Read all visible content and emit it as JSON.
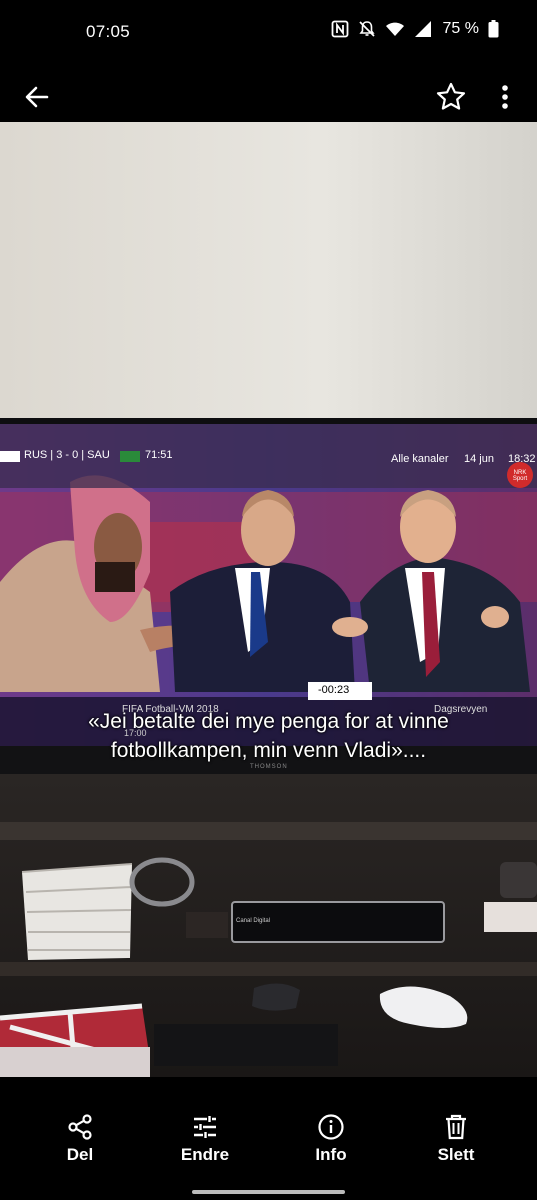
{
  "status": {
    "time": "07:05",
    "battery": "75 %",
    "icons": [
      "nfc-icon",
      "mute-icon",
      "wifi-icon",
      "signal-icon",
      "battery-icon"
    ]
  },
  "appbar": {
    "icons": [
      "back-arrow-icon",
      "star-icon",
      "more-vert-icon"
    ]
  },
  "photo": {
    "tv_overlay": {
      "score": "RUS | 3 - 0 | SAU",
      "match_time": "71:51",
      "channel_label": "Alle kanaler",
      "date": "14 jun",
      "clock": "18:32",
      "badge": "NRK Sport",
      "program": "FIFA Fotball-VM 2018",
      "program_time": "17:00",
      "next_program": "Dagsrevyen",
      "player_time": "-00:23",
      "brand": "THOMSON"
    },
    "caption_lines": [
      "«Jei betalte dei mye penga for at vinne",
      "fotbollkampen, min venn Vladi»...."
    ],
    "device_label": "Canal Digital"
  },
  "bottom_actions": [
    {
      "label": "Del",
      "icon": "share-icon"
    },
    {
      "label": "Endre",
      "icon": "tune-icon"
    },
    {
      "label": "Info",
      "icon": "info-icon"
    },
    {
      "label": "Slett",
      "icon": "trash-icon"
    }
  ]
}
